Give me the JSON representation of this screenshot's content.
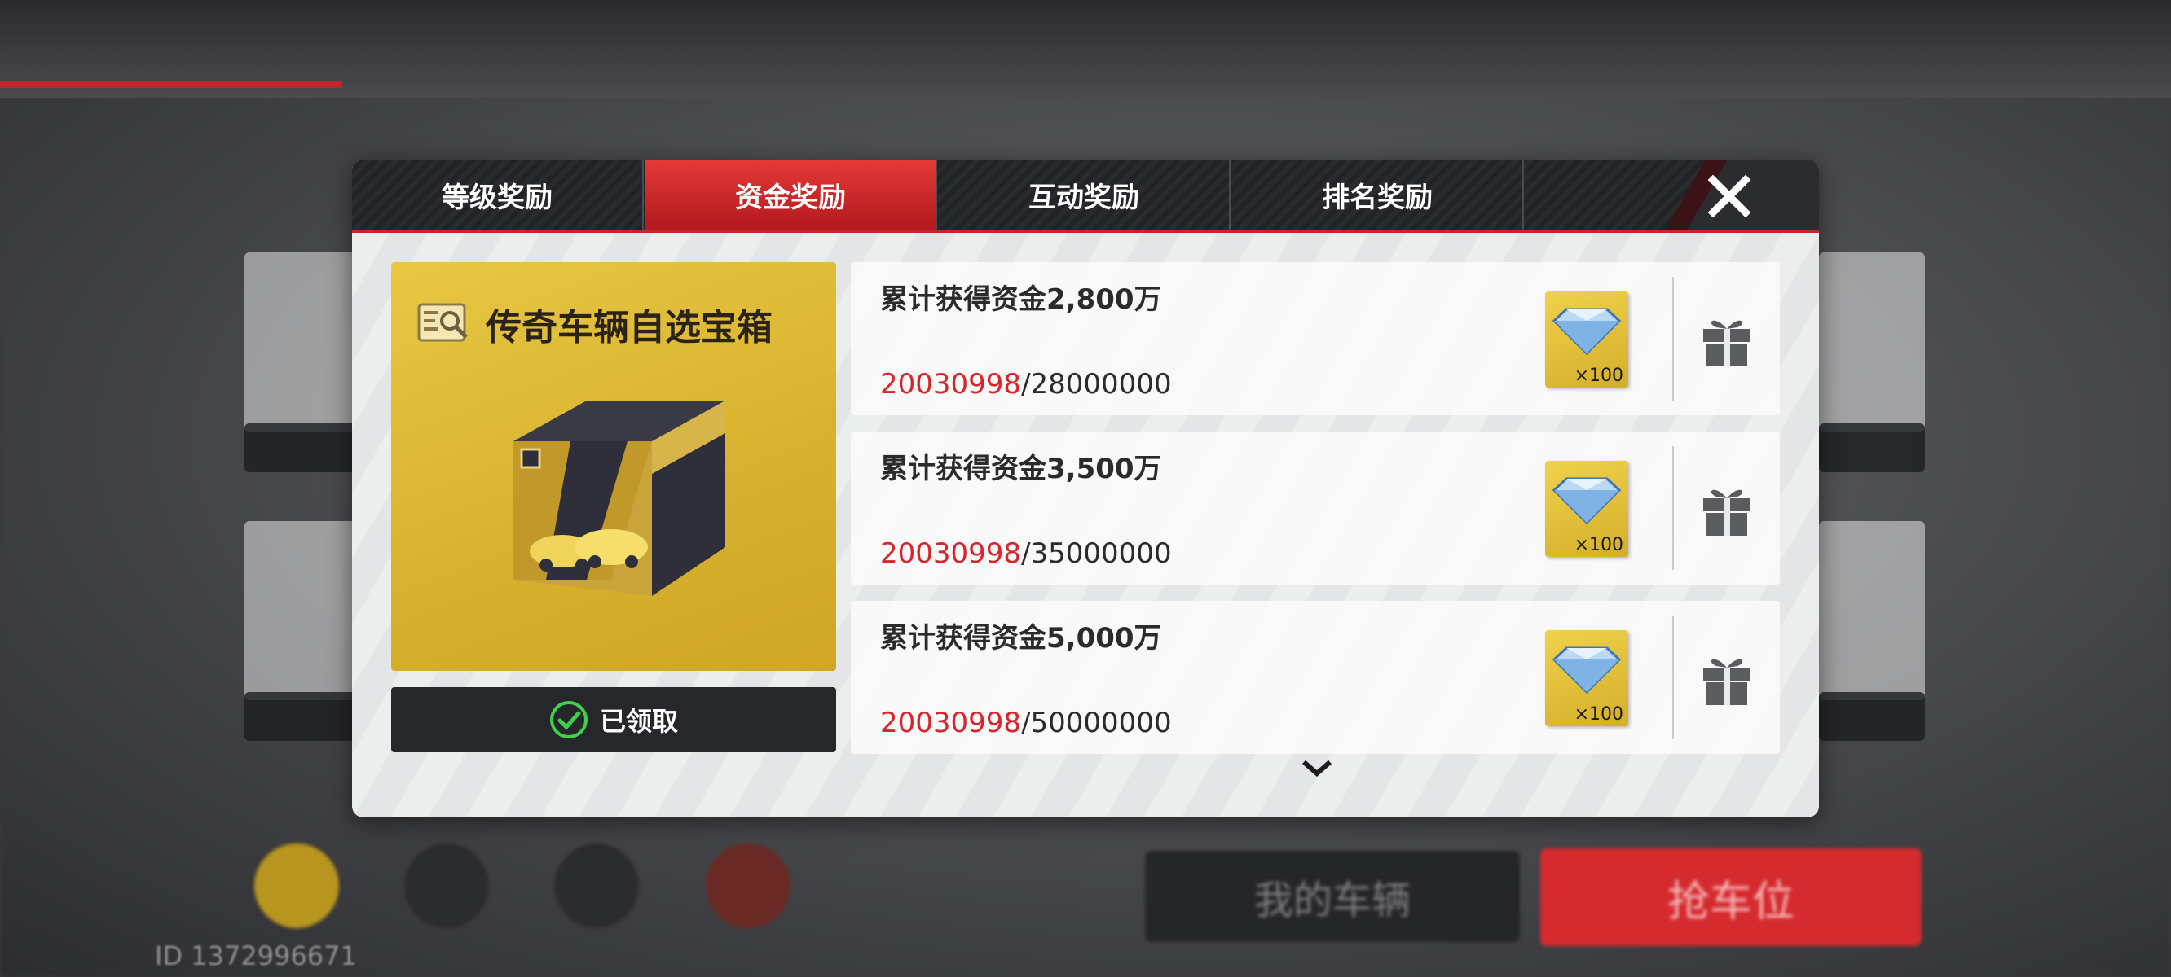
{
  "background": {
    "player_id": "ID 1372996671",
    "my_cars_label": "我的车辆",
    "garage_label": "抢车位"
  },
  "dialog": {
    "tabs": [
      {
        "label": "等级奖励",
        "active": false
      },
      {
        "label": "资金奖励",
        "active": true
      },
      {
        "label": "互动奖励",
        "active": false
      },
      {
        "label": "排名奖励",
        "active": false
      }
    ],
    "close_icon": "close-icon",
    "featured": {
      "title": "传奇车辆自选宝箱",
      "claimed_label": "已领取"
    },
    "rows": [
      {
        "title": "累计获得资金2,800万",
        "current": "20030998",
        "target": "/28000000",
        "reward_qty": "×100",
        "reward_icon": "diamond-icon"
      },
      {
        "title": "累计获得资金3,500万",
        "current": "20030998",
        "target": "/35000000",
        "reward_qty": "×100",
        "reward_icon": "diamond-icon"
      },
      {
        "title": "累计获得资金5,000万",
        "current": "20030998",
        "target": "/50000000",
        "reward_qty": "×100",
        "reward_icon": "diamond-icon"
      }
    ],
    "colors": {
      "accent_red": "#d6262c",
      "card_gold": "#dcb531",
      "tab_dark": "#26272b"
    }
  }
}
